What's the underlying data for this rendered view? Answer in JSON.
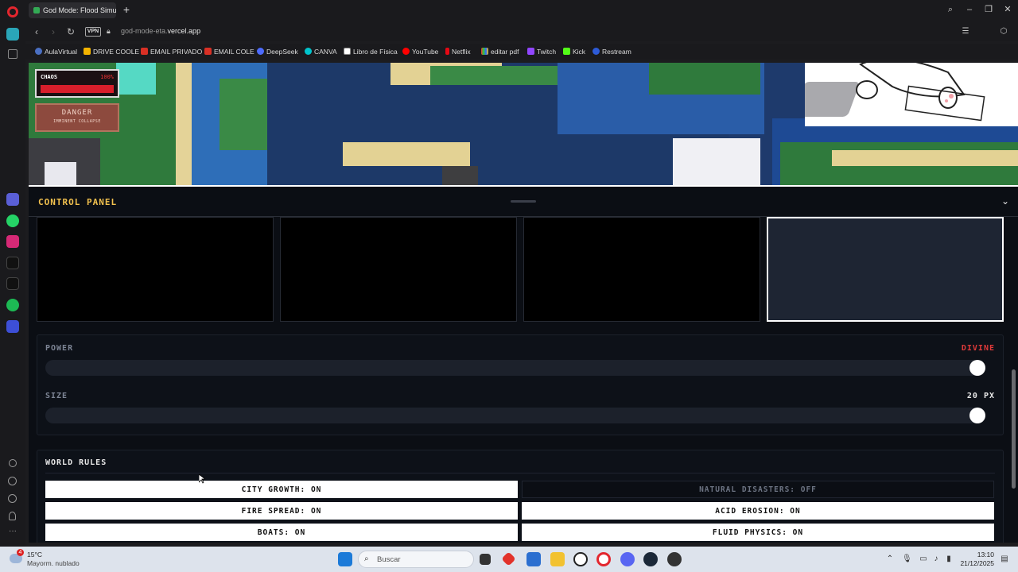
{
  "browser": {
    "tab_title": "God Mode: Flood Simulat",
    "url_host": "god-mode-eta.",
    "url_domain": "vercel.app",
    "vpn_label": "VPN"
  },
  "bookmarks": [
    "AulaVirtual",
    "DRIVE COOLE",
    "EMAIL PRIVADO",
    "EMAIL COLE",
    "DeepSeek",
    "CANVA",
    "Libro de Física",
    "YouTube",
    "Netflix",
    "editar pdf",
    "Twitch",
    "Kick",
    "Restream"
  ],
  "hud": {
    "chaos_label": "CHAOS",
    "chaos_value": "100%",
    "chaos_fill": 1.0,
    "danger_title": "DANGER",
    "danger_subtitle": "IMMINENT COLLAPSE"
  },
  "control_panel": {
    "title": "CONTROL PANEL"
  },
  "sliders": {
    "power": {
      "label": "POWER",
      "value": "DIVINE",
      "value_color": "#e03a3a",
      "fill": 1.0
    },
    "size": {
      "label": "SIZE",
      "value": "20 PX",
      "value_color": "#e8e8e8",
      "fill": 1.0
    }
  },
  "world_rules": {
    "title": "WORLD RULES",
    "rules": [
      {
        "label": "CITY GROWTH: ON",
        "state": "on"
      },
      {
        "label": "NATURAL DISASTERS: OFF",
        "state": "off"
      },
      {
        "label": "FIRE SPREAD: ON",
        "state": "on"
      },
      {
        "label": "ACID EROSION: ON",
        "state": "on"
      },
      {
        "label": "BOATS: ON",
        "state": "on"
      },
      {
        "label": "FLUID PHYSICS: ON",
        "state": "on"
      }
    ]
  },
  "taskbar": {
    "weather_temp": "15°C",
    "weather_desc": "Mayorm. nublado",
    "weather_badge": "4",
    "search_placeholder": "Buscar",
    "time": "13:10",
    "date": "21/12/2025"
  }
}
